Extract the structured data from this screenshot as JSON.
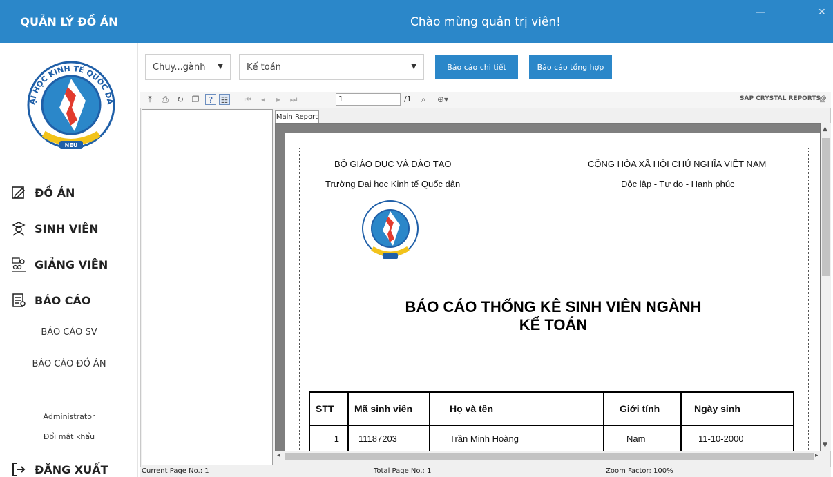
{
  "sidebar": {
    "app_title": "QUẢN LÝ ĐỒ ÁN",
    "nav": [
      {
        "label": "ĐỒ ÁN",
        "icon": "edit-icon"
      },
      {
        "label": "SINH VIÊN",
        "icon": "student-icon"
      },
      {
        "label": "GIẢNG VIÊN",
        "icon": "teacher-icon"
      },
      {
        "label": "BÁO CÁO",
        "icon": "report-icon"
      }
    ],
    "sub_items": [
      "BÁO CÁO SV",
      "BÁO CÁO ĐỒ ÁN"
    ],
    "user_name": "Administrator",
    "change_password": "Đổi mật khẩu",
    "logout": "ĐĂNG XUẤT"
  },
  "header": {
    "welcome": "Chào mừng quản trị viên!",
    "minimize": "—",
    "close": "✕"
  },
  "filters": {
    "type_value": "Chuy...gành",
    "major_value": "Kế toán",
    "btn_detail": "Báo cáo chi tiết",
    "btn_summary": "Báo cáo tổng hợp"
  },
  "viewer": {
    "page_value": "1",
    "page_total": "/1",
    "brand": "SAP CRYSTAL REPORTS®",
    "tab_label": "Main Report",
    "status_current": "Current Page No.: 1",
    "status_total": "Total Page No.: 1",
    "status_zoom": "Zoom Factor: 100%"
  },
  "report": {
    "ministry": "BỘ GIÁO DỤC VÀ ĐÀO TẠO",
    "school": "Trường Đại học Kinh tế Quốc dân",
    "republic": "CỘNG HÒA XÃ HỘI CHỦ NGHĨA VIỆT NAM",
    "motto": "Độc lập - Tự do - Hạnh phúc",
    "title_line1": "BÁO CÁO THỐNG KÊ SINH VIÊN NGÀNH",
    "title_line2": "KẾ TOÁN",
    "columns": [
      "STT",
      "Mã sinh viên",
      "Họ và tên",
      "Giới tính",
      "Ngày sinh"
    ],
    "rows": [
      [
        "1",
        "11187203",
        "Trần Minh Hoàng",
        "Nam",
        "11-10-2000"
      ]
    ]
  },
  "logo": {
    "text": "ĐẠI HỌC KINH TẾ QUỐC DÂN",
    "badge": "NEU"
  },
  "colors": {
    "primary": "#2b87c9",
    "logo_blue": "#1f5fa8",
    "logo_gold": "#f2c31b"
  }
}
